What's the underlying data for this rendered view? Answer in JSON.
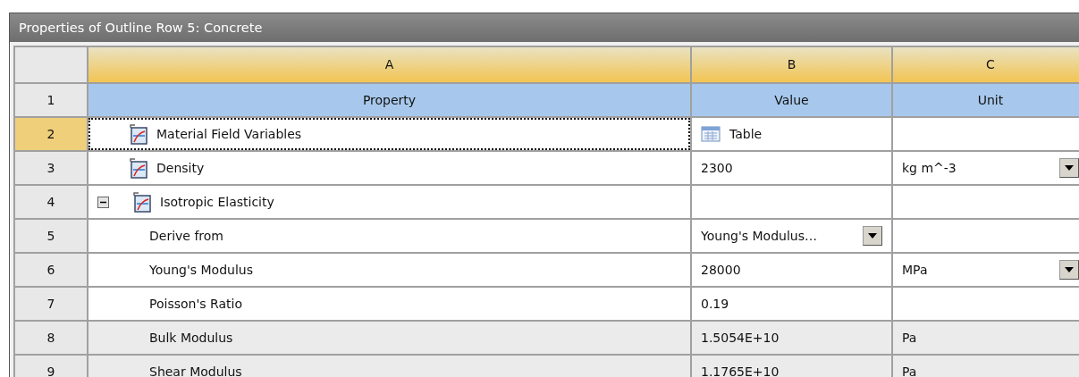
{
  "window": {
    "title": "Properties of Outline Row 5: Concrete"
  },
  "columns": [
    {
      "letter": "A"
    },
    {
      "letter": "B"
    },
    {
      "letter": "C"
    }
  ],
  "header_row": {
    "number": "1",
    "cells": [
      "Property",
      "Value",
      "Unit"
    ]
  },
  "rows": [
    {
      "number": "2",
      "kind": "chart",
      "selected": true,
      "readonly": false,
      "property": "Material Field Variables",
      "value": {
        "kind": "table",
        "text": "Table"
      }
    },
    {
      "number": "3",
      "kind": "chart",
      "selected": false,
      "readonly": false,
      "property": "Density",
      "value": {
        "kind": "text",
        "text": "2300"
      },
      "unit": {
        "text": "kg m^-3",
        "dropdown": true
      }
    },
    {
      "number": "4",
      "kind": "chart",
      "selected": false,
      "readonly": false,
      "expanded": true,
      "property": "Isotropic Elasticity",
      "children": [
        {
          "number": "5",
          "kind": "plain",
          "selected": false,
          "readonly": false,
          "property": "Derive from",
          "value": {
            "kind": "dropdown",
            "text": "Young's Modulus…"
          }
        },
        {
          "number": "6",
          "kind": "plain",
          "selected": false,
          "readonly": false,
          "property": "Young's Modulus",
          "value": {
            "kind": "text",
            "text": "28000"
          },
          "unit": {
            "text": "MPa",
            "dropdown": true
          }
        },
        {
          "number": "7",
          "kind": "plain",
          "selected": false,
          "readonly": false,
          "property": "Poisson's Ratio",
          "value": {
            "kind": "text",
            "text": "0.19"
          }
        },
        {
          "number": "8",
          "kind": "plain",
          "selected": false,
          "readonly": true,
          "property": "Bulk Modulus",
          "value": {
            "kind": "text",
            "text": "1.5054E+10"
          },
          "unit": {
            "text": "Pa",
            "dropdown": false
          }
        },
        {
          "number": "9",
          "kind": "plain",
          "selected": false,
          "readonly": true,
          "property": "Shear Modulus",
          "value": {
            "kind": "text",
            "text": "1.1765E+10"
          },
          "unit": {
            "text": "Pa",
            "dropdown": false
          }
        }
      ]
    }
  ]
}
